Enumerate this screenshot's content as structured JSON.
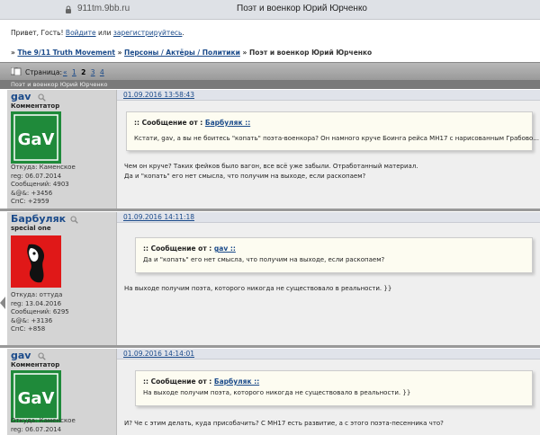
{
  "browser": {
    "url": "911tm.9bb.ru",
    "title": "Поэт и военкор Юрий Юрченко"
  },
  "header": {
    "greeting": "Привет, Гость!",
    "login": "Войдите",
    "or": "или",
    "register": "зарегистрируйтесь",
    "dot": "."
  },
  "breadcrumb": {
    "sep": "»",
    "forum": "The 9/11 Truth Movement",
    "section": "Персоны / Актёры / Политики",
    "topic": "Поэт и военкор Юрий Юрченко"
  },
  "pager": {
    "label": "Страница:",
    "prev": "«",
    "pages": [
      "1",
      "2",
      "3",
      "4"
    ],
    "current": "2"
  },
  "topic_bar": "Поэт и военкор Юрий Юрченко",
  "posts": [
    {
      "author": "gav",
      "role": "Комментатор",
      "avatar_text": "GaV",
      "stats": [
        "Откуда: Каменское",
        "reg: 06.07.2014",
        "Сообщений: 4903",
        "&@&: +3456",
        "СпС: +2959"
      ],
      "date": "01.09.2016 13:58:43",
      "quote_prefix": ":: Сообщение от :",
      "quote_author": "Барбуляк ::",
      "quote_text": "Кстати, gav, а вы не боитесь \"копать\" поэта-военкора? Он намного круче Боинга рейса МН17 с нарисованным Грабово... }}})",
      "text": [
        "Чем он круче? Таких фейков было вагон, все всё уже забыли. Отработанный материал.",
        "Да и \"копать\" его нет смысла, что получим на выходе, если раскопаем?"
      ]
    },
    {
      "author": "Барбуляк",
      "role": "special one",
      "stats": [
        "Откуда: оттуда",
        "reg: 13.04.2016",
        "Сообщений: 6295",
        "&@&: +3136",
        "СпС: +858"
      ],
      "date": "01.09.2016 14:11:18",
      "quote_prefix": ":: Сообщение от :",
      "quote_author": "gav ::",
      "quote_text": "Да и \"копать\" его нет смысла, что получим на выходе, если раскопаем?",
      "text": [
        "На выходе получим поэта, которого никогда не существовало в реальности. }}"
      ]
    },
    {
      "author": "gav",
      "role": "Комментатор",
      "avatar_text": "GaV",
      "stats": [
        "Откуда: Каменское",
        "reg: 06.07.2014"
      ],
      "date": "01.09.2016 14:14:01",
      "quote_prefix": ":: Сообщение от :",
      "quote_author": "Барбуляк ::",
      "quote_text": "На выходе получим поэта, которого никогда не существовало в реальности. }}",
      "text": [
        "И? Че с этим делать, куда присобачить? С МН17 есть развитие, а с этого поэта-песенника что?"
      ]
    }
  ]
}
